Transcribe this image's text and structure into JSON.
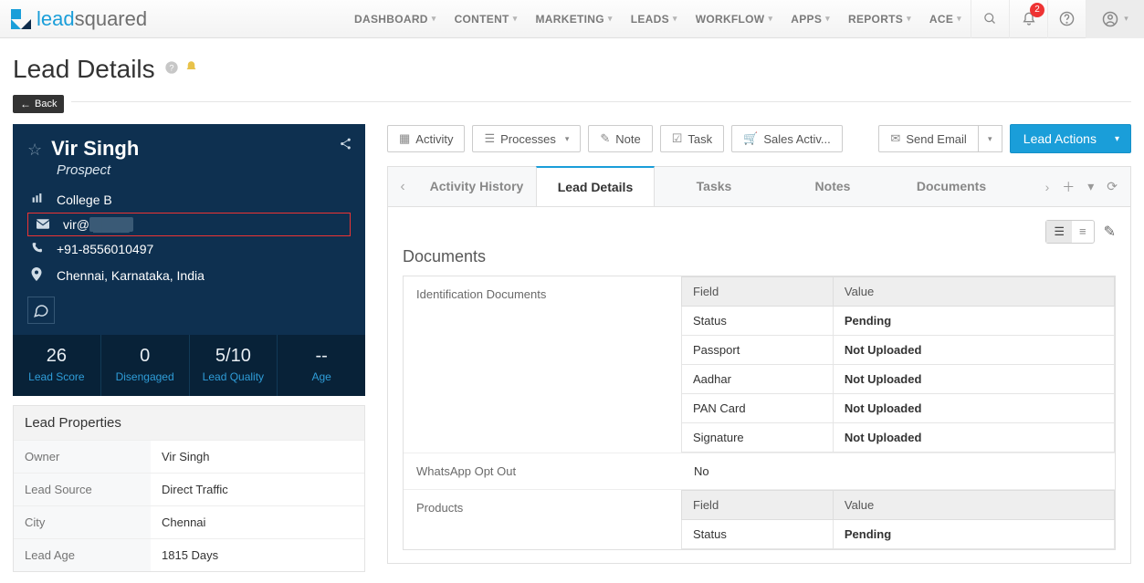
{
  "brand": {
    "lead": "lead",
    "squared": "squared"
  },
  "nav": {
    "items": [
      "DASHBOARD",
      "CONTENT",
      "MARKETING",
      "LEADS",
      "WORKFLOW",
      "APPS",
      "REPORTS",
      "ACE"
    ],
    "notif_count": "2"
  },
  "page": {
    "title": "Lead Details",
    "back": "Back"
  },
  "lead": {
    "name": "Vir Singh",
    "stage": "Prospect",
    "company": "College B",
    "email_prefix": "vir@",
    "email_masked": "████",
    "phone": "+91-8556010497",
    "location": "Chennai, Karnataka, India",
    "stats": [
      {
        "val": "26",
        "lbl": "Lead Score"
      },
      {
        "val": "0",
        "lbl": "Disengaged"
      },
      {
        "val": "5/10",
        "lbl": "Lead Quality"
      },
      {
        "val": "--",
        "lbl": "Age"
      }
    ]
  },
  "properties": {
    "title": "Lead Properties",
    "rows": [
      {
        "k": "Owner",
        "v": "Vir Singh"
      },
      {
        "k": "Lead Source",
        "v": "Direct Traffic"
      },
      {
        "k": "City",
        "v": "Chennai"
      },
      {
        "k": "Lead Age",
        "v": "1815 Days"
      }
    ]
  },
  "actions": {
    "activity": "Activity",
    "processes": "Processes",
    "note": "Note",
    "task": "Task",
    "sales": "Sales Activ...",
    "send_email": "Send Email",
    "lead_actions": "Lead Actions"
  },
  "tabs": [
    "Activity History",
    "Lead Details",
    "Tasks",
    "Notes",
    "Documents"
  ],
  "section": {
    "title": "Documents",
    "header_field": "Field",
    "header_value": "Value",
    "rows": [
      {
        "label": "Identification Documents",
        "type": "table",
        "data": [
          {
            "k": "Status",
            "v": "Pending",
            "strong": true
          },
          {
            "k": "Passport",
            "v": "Not Uploaded",
            "strong": true
          },
          {
            "k": "Aadhar",
            "v": "Not Uploaded",
            "strong": true
          },
          {
            "k": "PAN Card",
            "v": "Not Uploaded",
            "strong": true
          },
          {
            "k": "Signature",
            "v": "Not Uploaded",
            "strong": true
          }
        ]
      },
      {
        "label": "WhatsApp Opt Out",
        "type": "simple",
        "value": "No"
      },
      {
        "label": "Products",
        "type": "table",
        "data": [
          {
            "k": "Status",
            "v": "Pending",
            "strong": true
          }
        ]
      }
    ]
  }
}
